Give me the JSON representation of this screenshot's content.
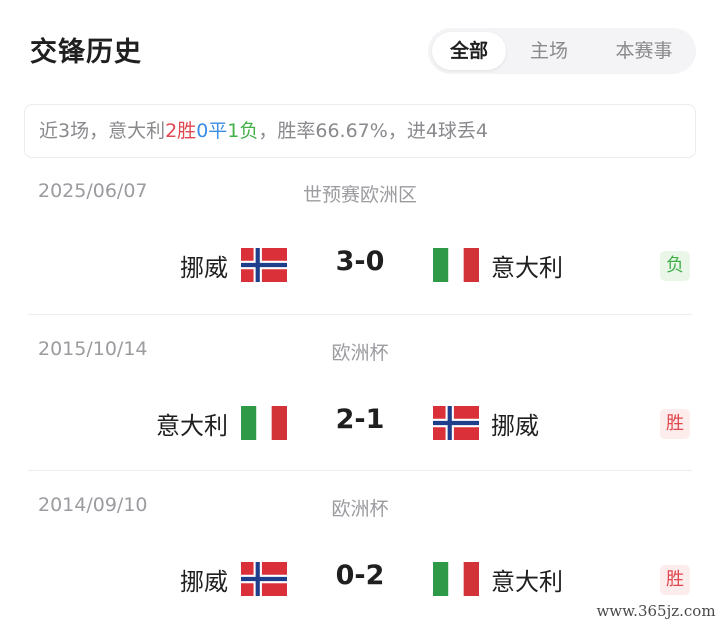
{
  "header": {
    "title": "交锋历史",
    "tabs": [
      {
        "label": "全部",
        "active": true
      },
      {
        "label": "主场",
        "active": false
      },
      {
        "label": "本赛事",
        "active": false
      }
    ]
  },
  "summary": {
    "prefix": "近3场，意大利",
    "wins": "2胜",
    "draws": "0平",
    "losses": "1负",
    "suffix": "，胜率66.67%，进4球丢4"
  },
  "matches": [
    {
      "date": "2025/06/07",
      "competition": "世预赛欧洲区",
      "home": "挪威",
      "home_flag": "norway-flag",
      "score": "3-0",
      "away": "意大利",
      "away_flag": "italy-flag",
      "result": "负",
      "result_type": "loss"
    },
    {
      "date": "2015/10/14",
      "competition": "欧洲杯",
      "home": "意大利",
      "home_flag": "italy-flag",
      "score": "2-1",
      "away": "挪威",
      "away_flag": "norway-flag",
      "result": "胜",
      "result_type": "win"
    },
    {
      "date": "2014/09/10",
      "competition": "欧洲杯",
      "home": "挪威",
      "home_flag": "norway-flag",
      "score": "0-2",
      "away": "意大利",
      "away_flag": "italy-flag",
      "result": "胜",
      "result_type": "win"
    }
  ],
  "colors": {
    "win": "#e0484f",
    "draw": "#3a8ee6",
    "loss": "#43b04a",
    "italy_green": "#2e9a48",
    "italy_red": "#d23339",
    "norway_red": "#d9303a",
    "norway_blue": "#1f3f8c"
  },
  "watermark": "www.365jz.com"
}
